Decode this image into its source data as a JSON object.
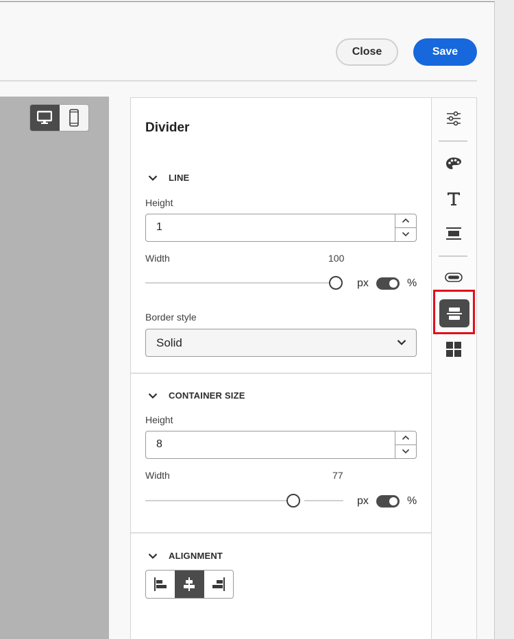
{
  "header": {
    "close_label": "Close",
    "save_label": "Save"
  },
  "device_toggle": {
    "options": [
      "desktop-icon",
      "mobile-icon"
    ],
    "selected": "desktop"
  },
  "panel": {
    "title": "Divider",
    "line": {
      "heading": "LINE",
      "height_label": "Height",
      "height_value": "1",
      "width_label": "Width",
      "width_value": "100",
      "width_level_percent": 100,
      "unit_px": "px",
      "unit_percent": "%",
      "border_style_label": "Border style",
      "border_style_value": "Solid"
    },
    "container": {
      "heading": "CONTAINER SIZE",
      "height_label": "Height",
      "height_value": "8",
      "width_label": "Width",
      "width_value": "77",
      "width_level_percent": 77,
      "unit_px": "px",
      "unit_percent": "%"
    },
    "alignment": {
      "heading": "ALIGNMENT",
      "options": [
        "align-left-icon",
        "align-center-icon",
        "align-right-icon"
      ],
      "selected": "center"
    }
  },
  "rail": {
    "icons": [
      "sliders-icon",
      "palette-icon",
      "text-icon",
      "divider-spacing-icon",
      "button-icon",
      "divider-icon",
      "grid-icon"
    ],
    "active": "divider-icon"
  },
  "colors": {
    "accent": "#1668dc",
    "dark": "#4b4b4b",
    "highlight": "#e0101a",
    "canvas": "#b3b3b3"
  }
}
